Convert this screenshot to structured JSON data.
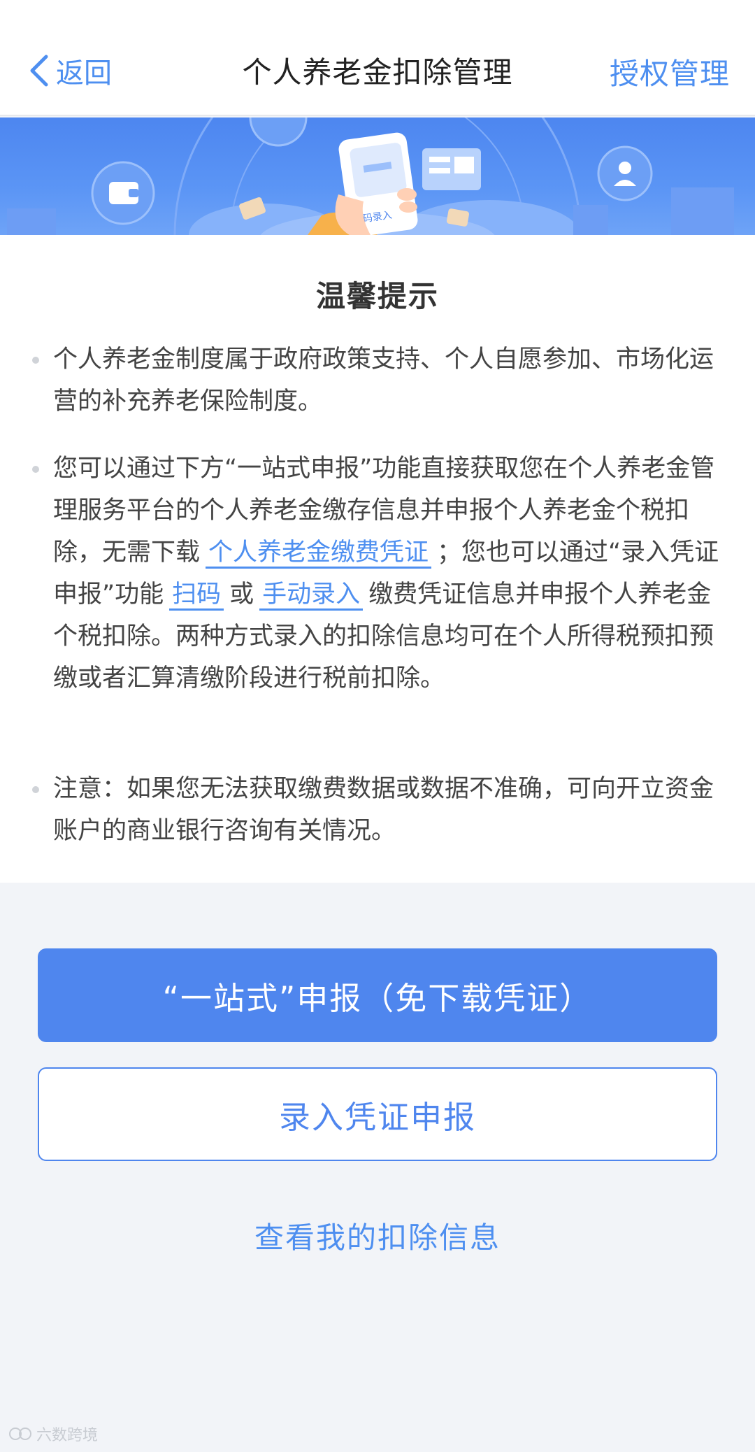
{
  "header": {
    "back_label": "返回",
    "title": "个人养老金扣除管理",
    "auth_label": "授权管理"
  },
  "banner": {
    "phone_label": "扫码录入"
  },
  "tips": {
    "title": "温馨提示",
    "item1": "个人养老金制度属于政府政策支持、个人自愿参加、市场化运营的补充养老保险制度。",
    "item2": {
      "part1": "您可以通过下方“一站式申报”功能直接获取您在个人养老金管理服务平台的个人养老金缴存信息并申报个人养老金个税扣除，无需下载",
      "link1": "个人养老金缴费凭证",
      "part2": "；您也可以通过“录入凭证申报”功能",
      "link2": "扫码",
      "part3": "或",
      "link3": "手动录入",
      "part4": "缴费凭证信息并申报个人养老金个税扣除。两种方式录入的扣除信息均可在个人所得税预扣预缴或者汇算清缴阶段进行税前扣除。"
    },
    "item3": "注意：如果您无法获取缴费数据或数据不准确，可向开立资金账户的商业银行咨询有关情况。"
  },
  "actions": {
    "primary_label": "“一站式”申报（免下载凭证）",
    "secondary_label": "录入凭证申报",
    "view_label": "查看我的扣除信息"
  },
  "watermark": "六数跨境",
  "colors": {
    "accent": "#4f86ee",
    "link": "#4e8ff0",
    "background": "#f2f4f8"
  },
  "icons": [
    "chevron-left-icon",
    "wallet-icon",
    "person-icon",
    "scan-phone-icon"
  ]
}
